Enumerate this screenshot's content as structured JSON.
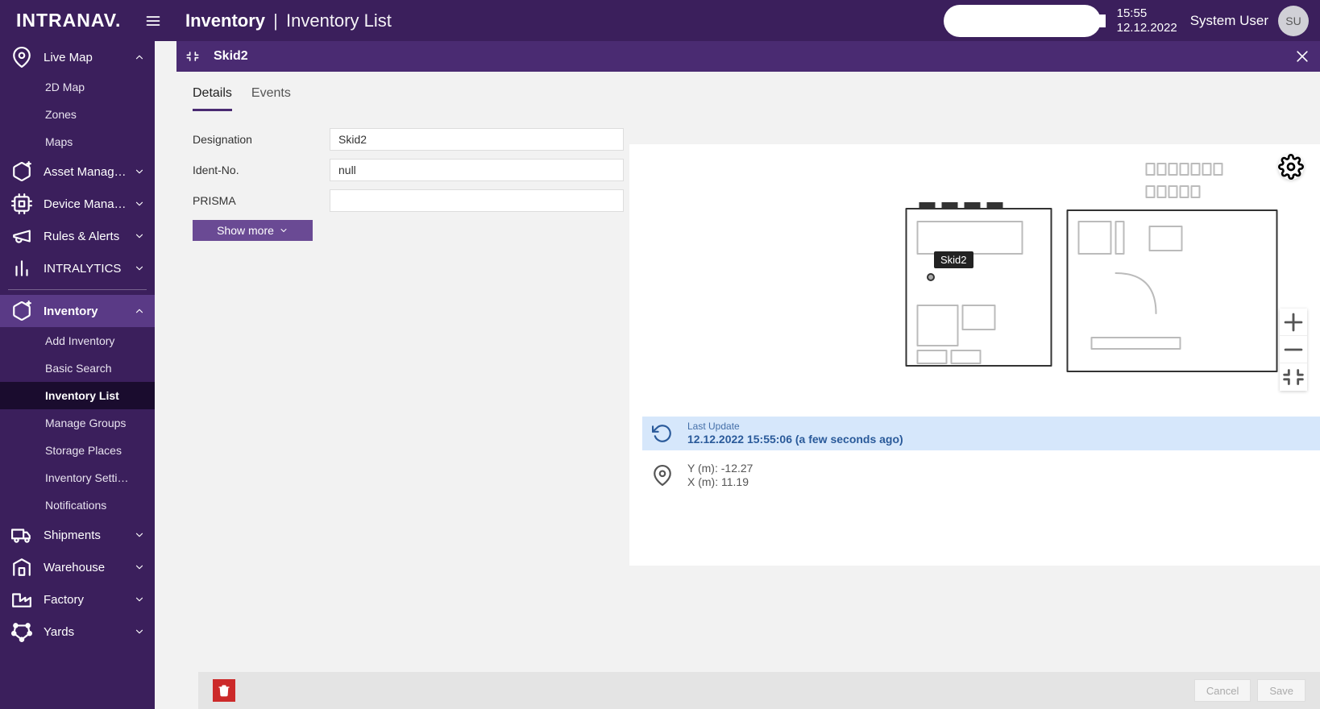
{
  "brand": "INTRANAV.",
  "breadcrumb": {
    "section": "Inventory",
    "page": "Inventory List"
  },
  "clock": {
    "time": "15:55",
    "date": "12.12.2022"
  },
  "user": {
    "name": "System User",
    "initials": "SU"
  },
  "search": {
    "placeholder": ""
  },
  "sidebar": [
    {
      "label": "Live Map",
      "icon": "map-pin",
      "expanded": true,
      "children": [
        {
          "label": "2D Map"
        },
        {
          "label": "Zones"
        },
        {
          "label": "Maps"
        }
      ]
    },
    {
      "label": "Asset Manag…",
      "icon": "cube-plus",
      "expandable": true
    },
    {
      "label": "Device Mana…",
      "icon": "cpu",
      "expandable": true
    },
    {
      "label": "Rules & Alerts",
      "icon": "megaphone",
      "expandable": true
    },
    {
      "label": "INTRALYTICS",
      "icon": "bar-chart",
      "expandable": true
    },
    {
      "separator": true
    },
    {
      "label": "Inventory",
      "icon": "cube-plus",
      "expanded": true,
      "active": true,
      "children": [
        {
          "label": "Add Inventory"
        },
        {
          "label": "Basic Search"
        },
        {
          "label": "Inventory List",
          "active": true
        },
        {
          "label": "Manage Groups"
        },
        {
          "label": "Storage Places"
        },
        {
          "label": "Inventory Setti…"
        },
        {
          "label": "Notifications"
        }
      ]
    },
    {
      "label": "Shipments",
      "icon": "truck",
      "expandable": true
    },
    {
      "label": "Warehouse",
      "icon": "warehouse",
      "expandable": true
    },
    {
      "label": "Factory",
      "icon": "factory",
      "expandable": true
    },
    {
      "label": "Yards",
      "icon": "polygon",
      "expandable": true
    }
  ],
  "detail": {
    "title": "Skid2",
    "tabs": [
      {
        "label": "Details",
        "active": true
      },
      {
        "label": "Events"
      }
    ],
    "fields": {
      "designation_label": "Designation",
      "designation_value": "Skid2",
      "identno_label": "Ident-No.",
      "identno_value": "null",
      "prisma_label": "PRISMA",
      "prisma_value": ""
    },
    "show_more": "Show more",
    "marker_label": "Skid2",
    "last_update": {
      "head": "Last Update",
      "line": "12.12.2022 15:55:06 (a few seconds ago)"
    },
    "coords": {
      "y": "Y (m): -12.27",
      "x": "X (m): 11.19"
    }
  },
  "footer": {
    "cancel": "Cancel",
    "save": "Save"
  }
}
